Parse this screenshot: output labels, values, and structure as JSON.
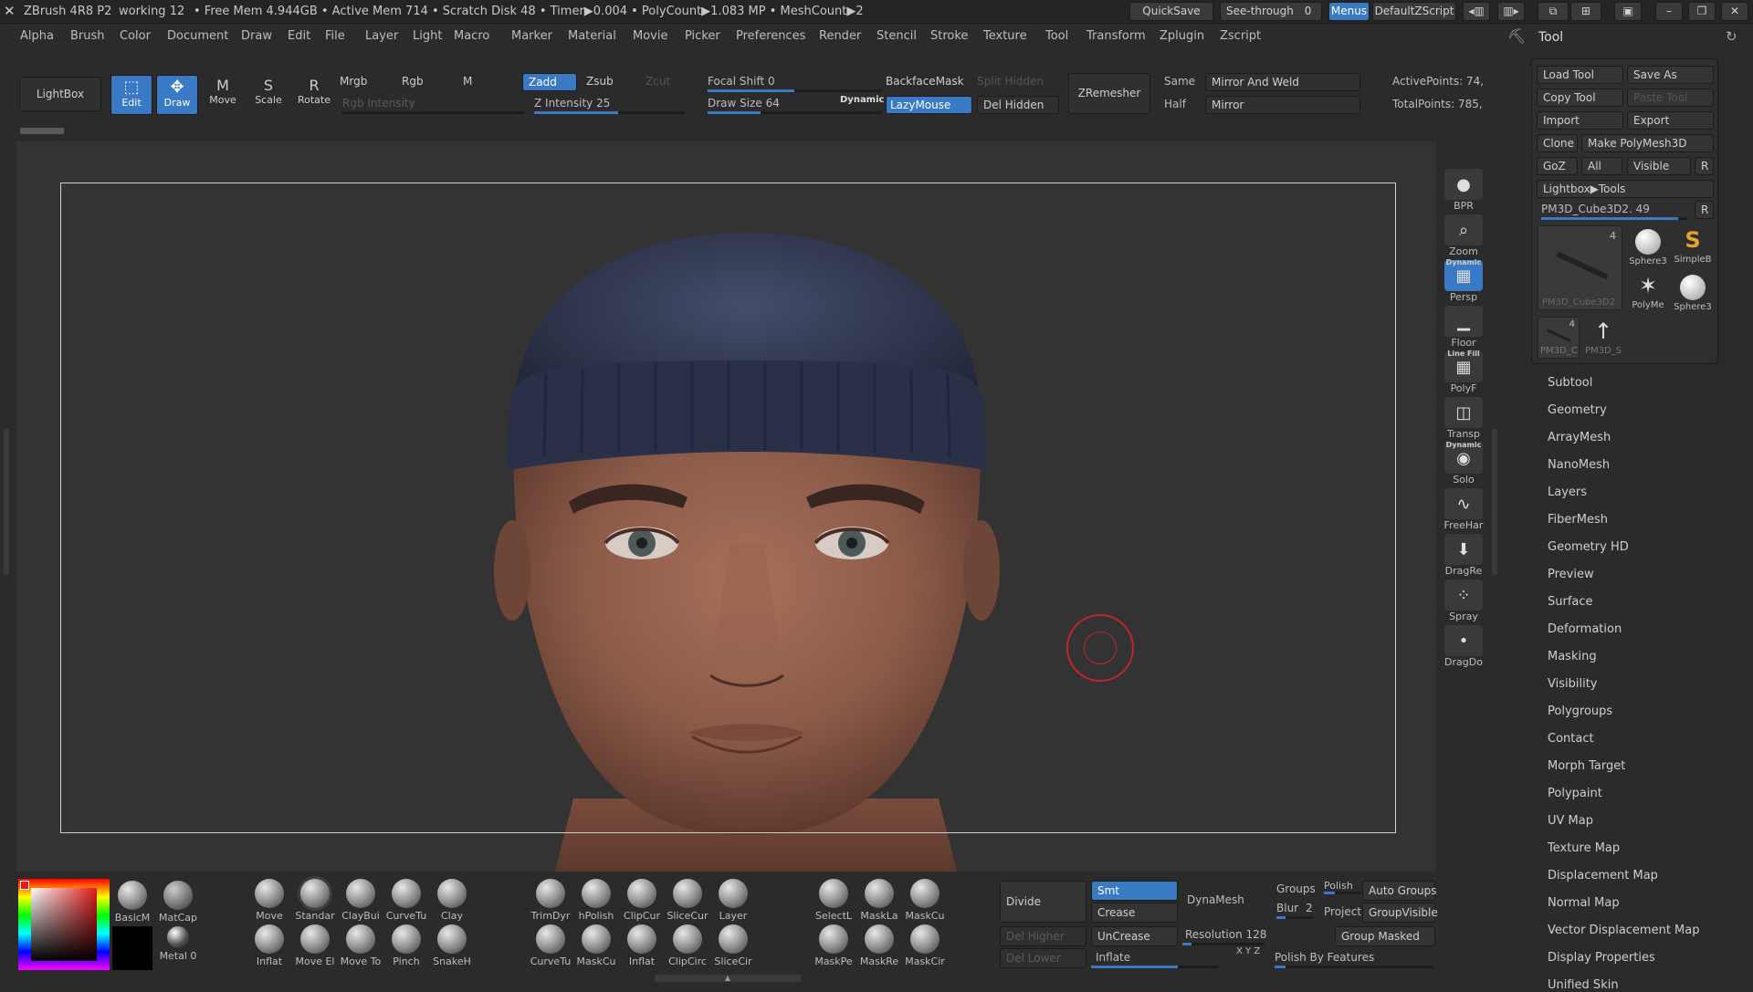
{
  "titlebar": {
    "app": "ZBrush 4R8 P2",
    "doc": "working 12",
    "stats": "• Free Mem 4.944GB • Active Mem 714 • Scratch Disk 48 • Timer▶0.004 • PolyCount▶1.083 MP • MeshCount▶2",
    "quicksave": "QuickSave",
    "seethrough": "See-through",
    "seethrough_value": "0",
    "menus": "Menus",
    "zscript": "DefaultZScript"
  },
  "menubar": [
    "Alpha",
    "Brush",
    "Color",
    "Document",
    "Draw",
    "Edit",
    "File",
    "Layer",
    "Light",
    "Macro",
    "Marker",
    "Material",
    "Movie",
    "Picker",
    "Preferences",
    "Render",
    "Stencil",
    "Stroke",
    "Texture",
    "Tool",
    "Transform",
    "Zplugin",
    "Zscript"
  ],
  "shelf": {
    "lightbox": "LightBox",
    "edit": "Edit",
    "draw": "Draw",
    "move": "Move",
    "scale": "Scale",
    "rotate": "Rotate",
    "mrgb": "Mrgb",
    "rgb": "Rgb",
    "m": "M",
    "rgb_intensity": "Rgb Intensity",
    "zadd": "Zadd",
    "zsub": "Zsub",
    "zcut": "Zcut",
    "z_intensity": "Z Intensity 25",
    "focal_shift": "Focal Shift 0",
    "draw_size": "Draw Size 64",
    "dynamic": "Dynamic",
    "backfacemask": "BackfaceMask",
    "split_hidden": "Split Hidden",
    "lazymouse": "LazyMouse",
    "del_hidden": "Del Hidden",
    "zremesher": "ZRemesher",
    "same": "Same",
    "half": "Half",
    "mirror_weld": "Mirror And Weld",
    "mirror": "Mirror",
    "active_points": "ActivePoints: 74,",
    "total_points": "TotalPoints: 785,"
  },
  "right_shelf": [
    {
      "label": "BPR",
      "icon": "bpr-sphere-icon"
    },
    {
      "label": "Zoom",
      "icon": "zoom-icon"
    },
    {
      "label": "Persp",
      "icon": "perspective-grid-icon",
      "top": "Dynamic"
    },
    {
      "label": "Floor",
      "icon": "floor-icon"
    },
    {
      "label": "PolyF",
      "icon": "polyframe-icon",
      "top": "Line Fill"
    },
    {
      "label": "Transp",
      "icon": "transparency-icon"
    },
    {
      "label": "Solo",
      "icon": "solo-icon",
      "top": "Dynamic"
    },
    {
      "label": "FreeHar",
      "icon": "freehand-stroke-icon"
    },
    {
      "label": "DragRe",
      "icon": "dragrect-stroke-icon"
    },
    {
      "label": "Spray",
      "icon": "spray-stroke-icon"
    },
    {
      "label": "DragDo",
      "icon": "dragdot-stroke-icon"
    }
  ],
  "tool_panel": {
    "title": "Tool",
    "load_tool": "Load Tool",
    "save_as": "Save As",
    "copy_tool": "Copy Tool",
    "paste_tool": "Paste Tool",
    "import": "Import",
    "export": "Export",
    "clone": "Clone",
    "make_polymesh": "Make PolyMesh3D",
    "goz": "GoZ",
    "all": "All",
    "visible": "Visible",
    "r": "R",
    "lightbox_tools": "Lightbox▶Tools",
    "current_tool": "PM3D_Cube3D2. 49",
    "thumbs": [
      {
        "label": "PM3D_Cube3D2",
        "count": "4"
      },
      {
        "label": "Sphere3"
      },
      {
        "label": "SimpleB"
      },
      {
        "label": "PolyMe"
      },
      {
        "label": "Sphere3"
      },
      {
        "label": "PM3D_C",
        "count": "4"
      },
      {
        "label": "PM3D_S"
      }
    ],
    "sections": [
      "Subtool",
      "Geometry",
      "ArrayMesh",
      "NanoMesh",
      "Layers",
      "FiberMesh",
      "Geometry HD",
      "Preview",
      "Surface",
      "Deformation",
      "Masking",
      "Visibility",
      "Polygroups",
      "Contact",
      "Morph Target",
      "Polypaint",
      "UV Map",
      "Texture Map",
      "Displacement Map",
      "Normal Map",
      "Vector Displacement Map",
      "Display Properties",
      "Unified Skin"
    ]
  },
  "bottom": {
    "materials": [
      "BasicM",
      "MatCap",
      "Metal 0"
    ],
    "brushes_row1": [
      "Move",
      "Standar",
      "ClayBui",
      "CurveTu",
      "Clay"
    ],
    "brushes_row2": [
      "Inflat",
      "Move El",
      "Move To",
      "Pinch",
      "SnakeH"
    ],
    "brushes2_row1": [
      "TrimDyr",
      "hPolish",
      "ClipCur",
      "SliceCur",
      "Layer"
    ],
    "brushes2_row2": [
      "CurveTu",
      "MaskCu",
      "Inflat",
      "ClipCirc",
      "SliceCir"
    ],
    "mask_row1": [
      "SelectL",
      "MaskLa",
      "MaskCu"
    ],
    "mask_row2": [
      "MaskPe",
      "MaskRe",
      "MaskCir"
    ],
    "divide": "Divide",
    "smt": "Smt",
    "crease": "Crease",
    "uncrease": "UnCrease",
    "del_higher": "Del Higher",
    "del_lower": "Del Lower",
    "dynamesh": "DynaMesh",
    "groups": "Groups",
    "polish": "Polish",
    "blur": "Blur",
    "blur_value": "2",
    "project": "Project",
    "resolution": "Resolution 128",
    "inflate": "Inflate",
    "auto_groups": "Auto Groups",
    "group_visible": "GroupVisible",
    "group_masked": "Group Masked",
    "polish_by_features": "Polish By Features",
    "xyz": "X Y Z"
  },
  "colors": {
    "accent": "#3a79c4",
    "bg": "#2b2b2b",
    "viewport": "#333333",
    "cursor": "#c0272d"
  }
}
